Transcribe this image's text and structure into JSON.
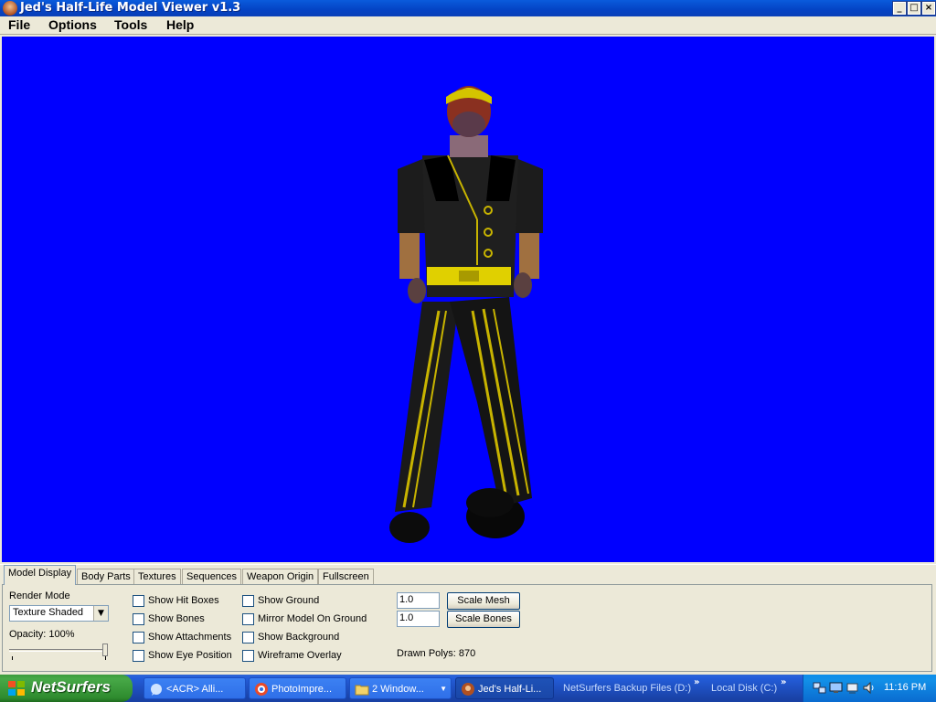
{
  "window": {
    "title": "Jed's Half-Life Model Viewer v1.3"
  },
  "menu": [
    "File",
    "Options",
    "Tools",
    "Help"
  ],
  "viewport": {
    "background": "#0000ff"
  },
  "tabs": [
    "Model Display",
    "Body Parts",
    "Textures",
    "Sequences",
    "Weapon Origin",
    "Fullscreen"
  ],
  "model_display": {
    "render_mode_label": "Render Mode",
    "render_mode_value": "Texture Shaded",
    "opacity_label": "Opacity: 100%",
    "opacity_value": 1.0,
    "checkboxes_col1": [
      "Show Hit Boxes",
      "Show Bones",
      "Show Attachments",
      "Show Eye Position"
    ],
    "checkboxes_col2": [
      "Show Ground",
      "Mirror Model On Ground",
      "Show Background",
      "Wireframe Overlay"
    ],
    "scale_mesh_value": "1.0",
    "scale_mesh_button": "Scale Mesh",
    "scale_bones_value": "1.0",
    "scale_bones_button": "Scale Bones",
    "drawn_polys": "Drawn Polys: 870"
  },
  "taskbar": {
    "start_label": "NetSurfers",
    "tasks": [
      "<ACR> Alli...",
      "PhotoImpre...",
      "2 Window...",
      "Jed's Half-Li..."
    ],
    "quicklinks": [
      "NetSurfers Backup Files (D:)",
      "Local Disk (C:)"
    ],
    "clock": "11:16 PM"
  }
}
